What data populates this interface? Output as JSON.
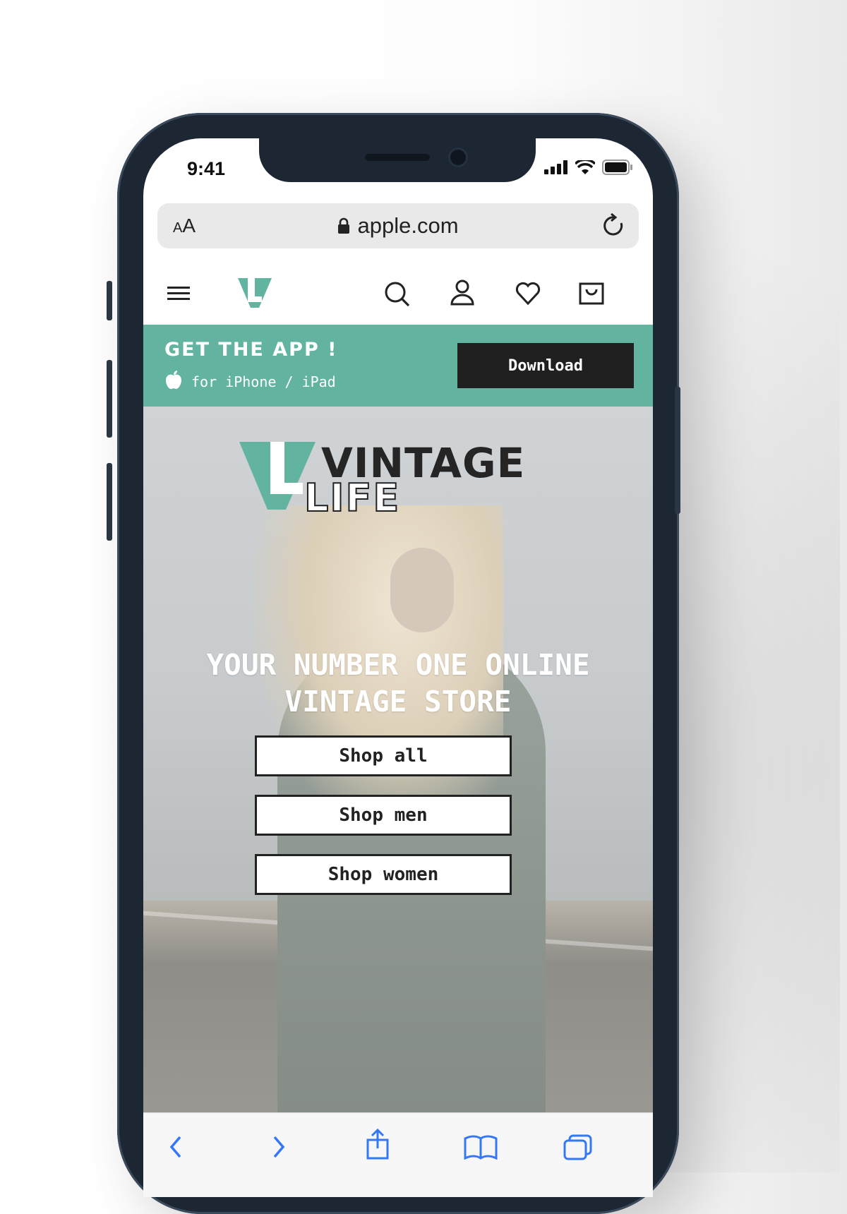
{
  "status_bar": {
    "time": "9:41"
  },
  "browser": {
    "text_size_label": "AA",
    "url": "apple.com"
  },
  "app_banner": {
    "title": "GET THE APP !",
    "subtitle": "for iPhone / iPad",
    "download_label": "Download",
    "background_color": "#62b4a1"
  },
  "hero": {
    "logo_word_top": "VINTAGE",
    "logo_word_bottom": "LIFE",
    "headline_line1": "YOUR NUMBER ONE ONLINE",
    "headline_line2": "VINTAGE STORE",
    "buttons": [
      "Shop all",
      "Shop men",
      "Shop women"
    ]
  },
  "colors": {
    "brand_teal": "#62b4a1",
    "dark": "#202020"
  }
}
